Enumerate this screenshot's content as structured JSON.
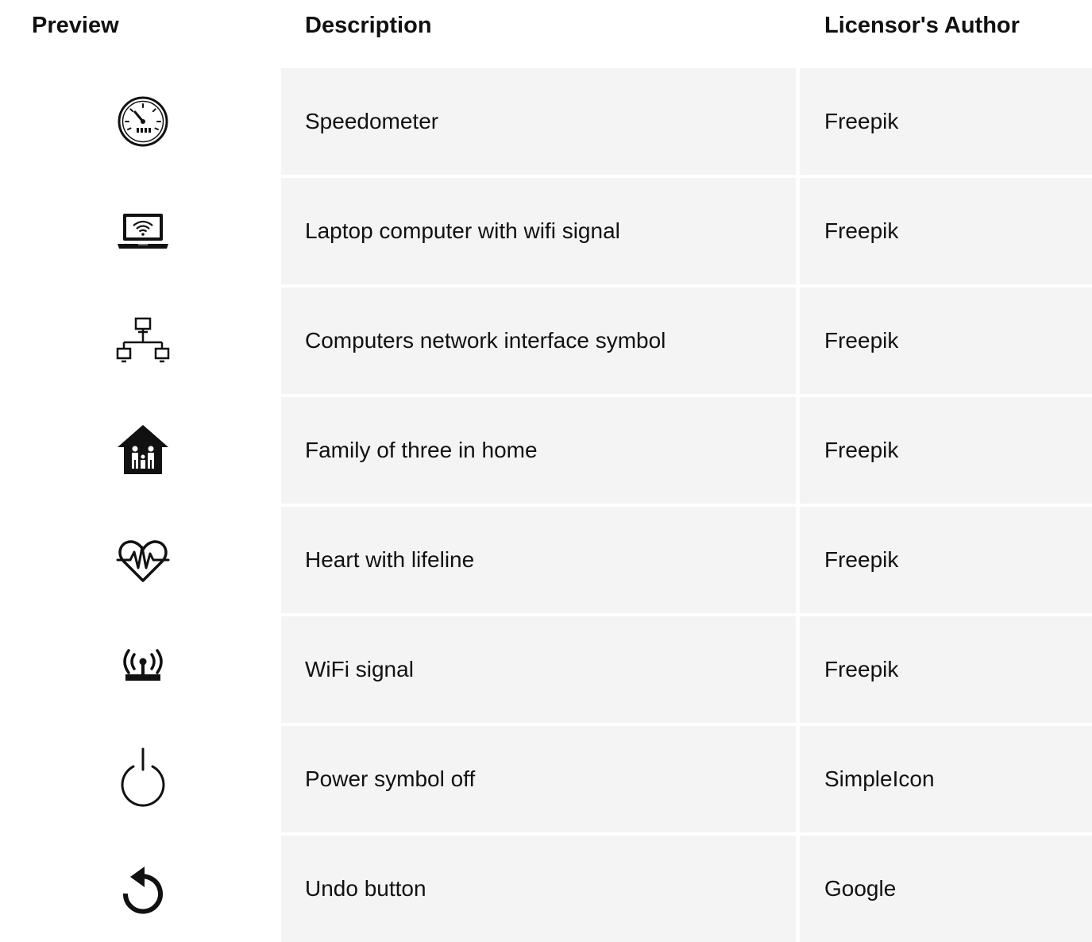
{
  "headers": {
    "preview": "Preview",
    "description": "Description",
    "author": "Licensor's Author"
  },
  "rows": [
    {
      "icon": "speedometer-icon",
      "description": "Speedometer",
      "author": "Freepik"
    },
    {
      "icon": "laptop-wifi-icon",
      "description": "Laptop computer with wifi signal",
      "author": "Freepik"
    },
    {
      "icon": "network-icon",
      "description": "Computers network interface symbol",
      "author": "Freepik"
    },
    {
      "icon": "family-home-icon",
      "description": "Family of three in home",
      "author": "Freepik"
    },
    {
      "icon": "heart-lifeline-icon",
      "description": "Heart with lifeline",
      "author": "Freepik"
    },
    {
      "icon": "wifi-signal-icon",
      "description": "WiFi signal",
      "author": "Freepik"
    },
    {
      "icon": "power-icon",
      "description": "Power symbol off",
      "author": "SimpleIcon"
    },
    {
      "icon": "undo-icon",
      "description": "Undo button",
      "author": "Google"
    }
  ]
}
